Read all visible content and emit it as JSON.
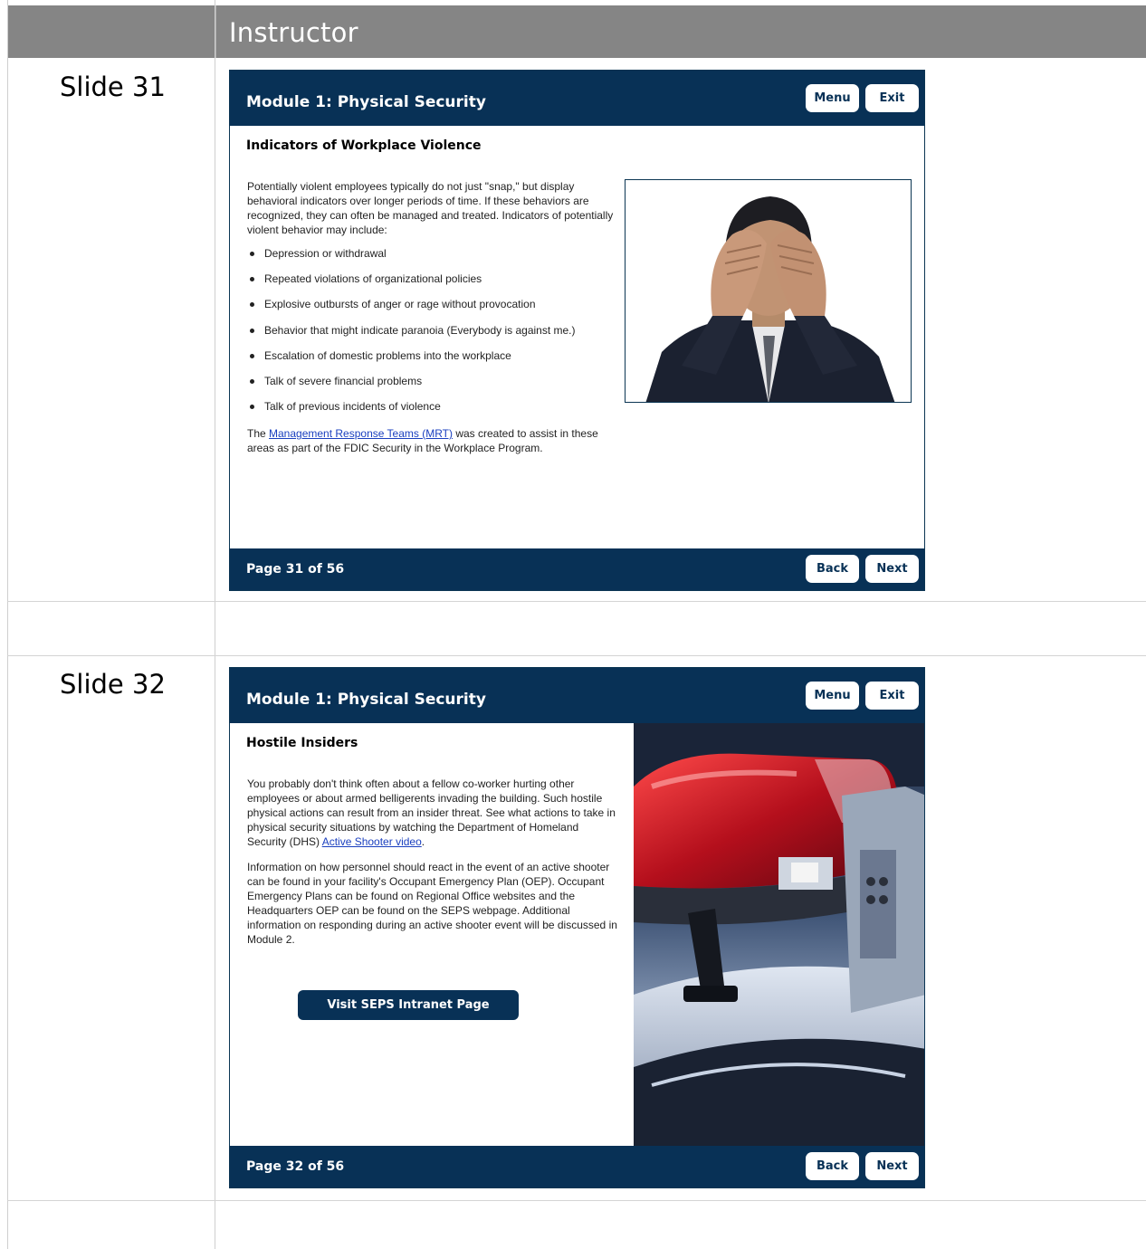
{
  "header": {
    "title": "Instructor"
  },
  "slides": [
    {
      "label": "Slide 31",
      "module_title": "Module 1: Physical Security",
      "menu_label": "Menu",
      "exit_label": "Exit",
      "heading": "Indicators of Workplace Violence",
      "intro": "Potentially violent employees typically do not just \"snap,\" but display behavioral indicators over longer periods of time. If these behaviors are recognized, they can often be managed and treated. Indicators of potentially violent behavior may include:",
      "bullets": [
        "Depression or withdrawal",
        "Repeated violations of organizational policies",
        "Explosive outbursts of anger or rage without provocation",
        "Behavior that might indicate paranoia (Everybody is against me.)",
        "Escalation of domestic problems into the workplace",
        "Talk of severe financial problems",
        "Talk of previous incidents of violence"
      ],
      "closing_before": "The ",
      "closing_link": "Management Response Teams (MRT)",
      "closing_after": " was created to assist in these areas as part of the FDIC Security in the Workplace Program.",
      "page": "Page 31 of 56",
      "back_label": "Back",
      "next_label": "Next"
    },
    {
      "label": "Slide 32",
      "module_title": "Module 1: Physical Security",
      "menu_label": "Menu",
      "exit_label": "Exit",
      "heading": "Hostile Insiders",
      "para1_before": "You probably don't think often about a fellow co-worker hurting other employees or about armed belligerents invading the building. Such hostile physical actions can result from an insider threat. See what actions to take in physical security situations by watching the Department of Homeland Security (DHS) ",
      "para1_link": "Active Shooter video",
      "para1_after": ".",
      "para2": "Information on how personnel should react in the event of an active shooter can be found in your facility's Occupant Emergency Plan (OEP). Occupant Emergency Plans can be found on Regional Office websites and the Headquarters OEP can be found on the SEPS webpage. Additional information on responding during an active shooter event will be discussed in Module 2.",
      "button_label": "Visit SEPS Intranet Page",
      "page": "Page 32 of 56",
      "back_label": "Back",
      "next_label": "Next"
    }
  ]
}
